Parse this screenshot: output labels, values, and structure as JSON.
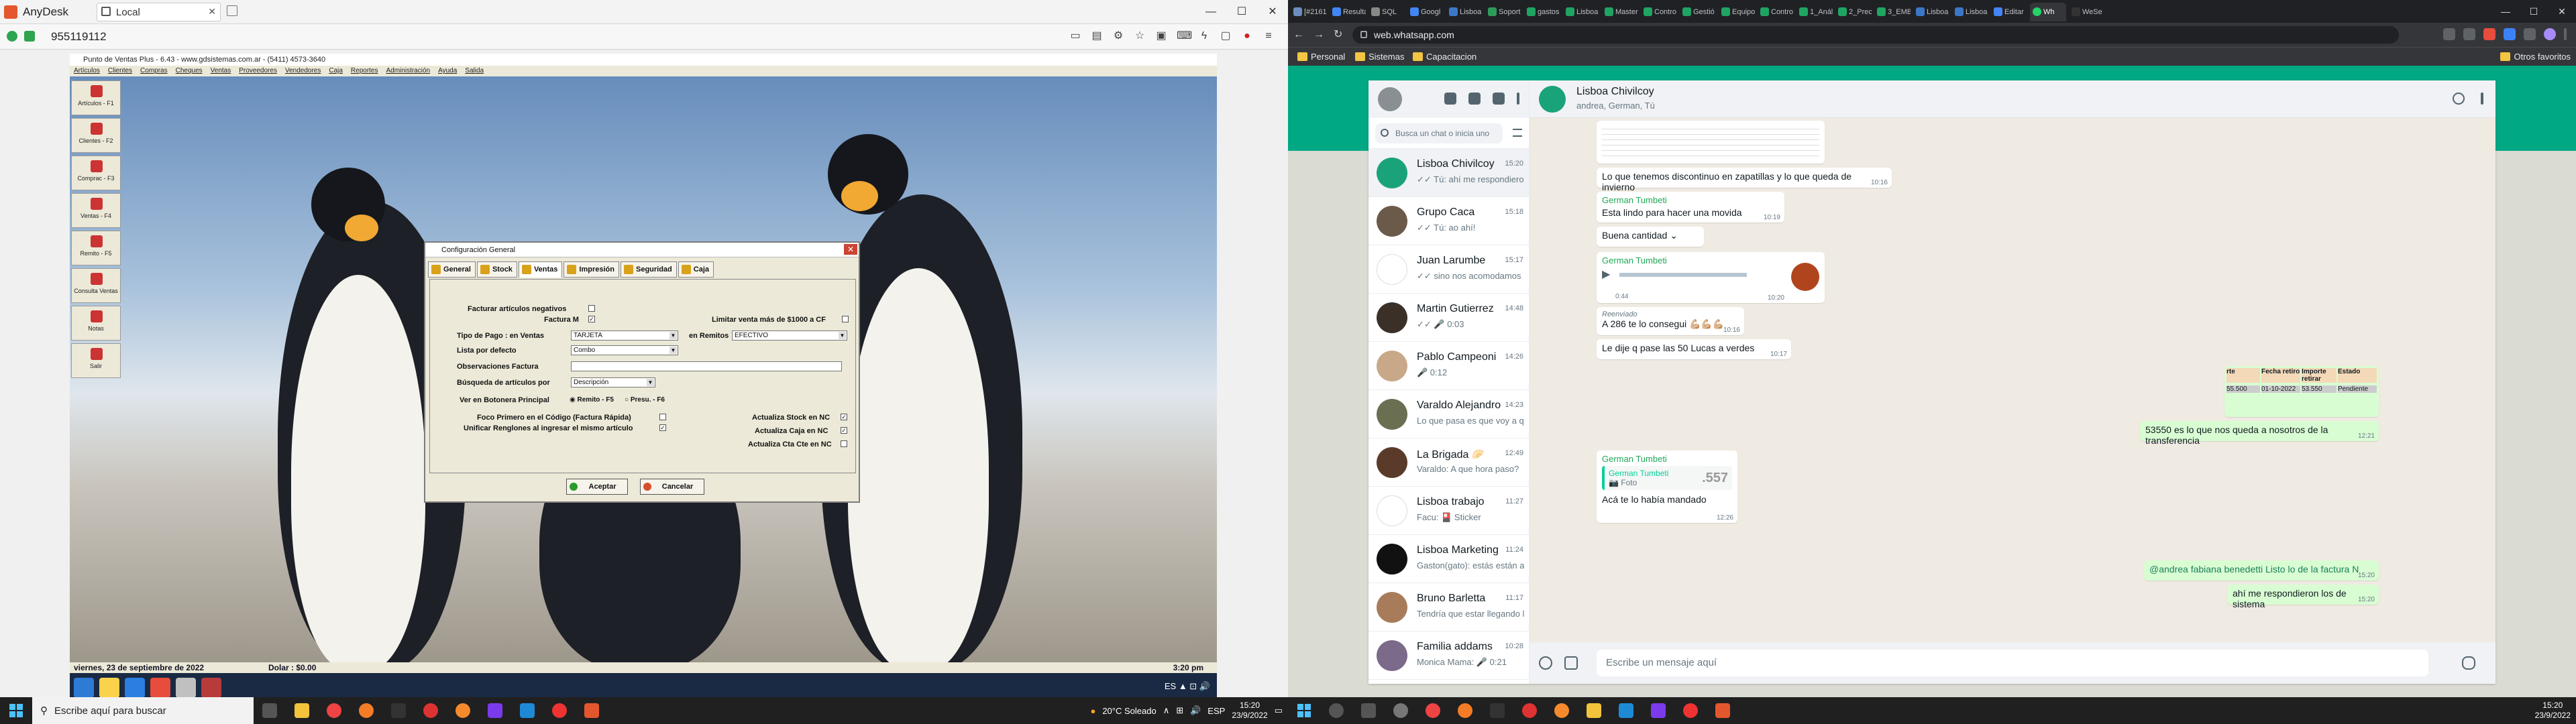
{
  "left": {
    "anydesk": {
      "app_name": "AnyDesk",
      "tab_label": "Local",
      "address": "955119112",
      "icons": [
        "chat-icon",
        "files-icon",
        "settings-icon",
        "star-icon",
        "monitor-icon",
        "keyboard-icon",
        "lightning-icon",
        "screenshot-icon",
        "record-icon",
        "menu-icon"
      ]
    },
    "pos": {
      "title": "Punto de Ventas Plus - 6.43 - www.gdsistemas.com.ar - (5411) 4573-3640",
      "menu": [
        "Artículos",
        "Clientes",
        "Compras",
        "Cheques",
        "Ventas",
        "Proveedores",
        "Vendedores",
        "Caja",
        "Reportes",
        "Administración",
        "Ayuda",
        "Salida"
      ],
      "side": [
        "Artículos - F1",
        "Clientes - F2",
        "Comprac - F3",
        "Ventas - F4",
        "Remito - F5",
        "Consulta Ventas",
        "Notas",
        "Salir"
      ],
      "status_date": "viernes, 23 de septiembre de 2022",
      "status_dolar": "Dolar : $0.00",
      "status_time": "3:20 pm"
    },
    "dialog": {
      "title": "Configuración General",
      "tabs": [
        "General",
        "Stock",
        "Ventas",
        "Impresión",
        "Seguridad",
        "Caja"
      ],
      "facturar_neg": "Facturar artículos negativos",
      "factura_m": "Factura M",
      "limitar": "Limitar venta más de $1000 a CF",
      "tipo_pago_lbl": "Tipo de Pago : en Ventas",
      "tipo_pago_val": "TARJETA",
      "remitos_lbl": "en Remitos",
      "remitos_val": "EFECTIVO",
      "lista_lbl": "Lista por defecto",
      "lista_val": "Combo",
      "obs_lbl": "Observaciones Factura",
      "busq_lbl": "Búsqueda de artículos por",
      "busq_val": "Descripción",
      "botonera_lbl": "Ver en Botonera Principal",
      "radio1": "Remito - F5",
      "radio2": "Presu. - F6",
      "foco": "Foco Primero en el Código (Factura Rápida)",
      "unificar": "Unificar Renglones al ingresar el mismo artículo",
      "act_stock": "Actualiza Stock en NC",
      "act_caja": "Actualiza Caja en NC",
      "act_cta": "Actualiza Cta Cte en NC",
      "ok": "Aceptar",
      "cancel": "Cancelar"
    },
    "taskbar": {
      "search": "Escribe aquí para buscar",
      "weather": "20°C Soleado",
      "lang": "ESP",
      "time": "15:20",
      "date": "23/9/2022"
    }
  },
  "right": {
    "chrome": {
      "tabs": [
        "[#2161",
        "Resulta",
        "SQL",
        "Googl",
        "Lisboa",
        "Soport",
        "gastos",
        "Lisboa",
        "Master",
        "Contro",
        "Gestió",
        "Equipo",
        "Contro",
        "1_Anál",
        "2_Prec",
        "3_EMB",
        "Lisboa",
        "Lisboa",
        "Editar",
        "Wh",
        "WeSe"
      ],
      "active_tab": 19,
      "url": "web.whatsapp.com",
      "bookmarks": [
        "Personal",
        "Sistemas",
        "Capacitacion"
      ],
      "other_bookmarks": "Otros favoritos"
    },
    "whatsapp": {
      "search_placeholder": "Busca un chat o inicia uno nuevo",
      "chats": [
        {
          "name": "Lisboa Chivilcoy",
          "time": "15:20",
          "preview": "✓✓ Tú: ahí me respondieron los de sistema"
        },
        {
          "name": "Grupo Caca",
          "time": "15:18",
          "preview": "✓✓ Tú: ao ahí!"
        },
        {
          "name": "Juan Larumbe",
          "time": "15:17",
          "preview": "✓✓ sino nos acomodamos"
        },
        {
          "name": "Martin Gutierrez",
          "time": "14:48",
          "preview": "✓✓ 🎤 0:03"
        },
        {
          "name": "Pablo Campeoni",
          "time": "14:26",
          "preview": "🎤 0:12"
        },
        {
          "name": "Varaldo Alejandro",
          "time": "14:23",
          "preview": "Lo que pasa es que voy a querer hacer algo con esa plata y..."
        },
        {
          "name": "La Brigada 🥟",
          "time": "12:49",
          "preview": "Varaldo: A que hora paso?"
        },
        {
          "name": "Lisboa trabajo",
          "time": "11:27",
          "preview": "Facu: 🎴 Sticker"
        },
        {
          "name": "Lisboa Marketing",
          "time": "11:24",
          "preview": "Gaston(gato): estás están andando en campañas de mensaje"
        },
        {
          "name": "Bruno Barletta",
          "time": "11:17",
          "preview": "Tendría que estar llegando la semana que viene"
        },
        {
          "name": "Familia addams",
          "time": "10:28",
          "preview": "Monica Mama: 🎤 0:21"
        }
      ],
      "header_name": "Lisboa Chivilcoy",
      "header_sub": "andrea, German, Tú",
      "msgs": {
        "m1": "Lo que tenemos discontinuo en zapatillas y lo que queda de invierno",
        "m1t": "10:16",
        "m2s": "German Tumbeti",
        "m2": "Esta lindo para hacer una movida",
        "m2t": "10:19",
        "poll": "Buena cantidad",
        "m3s": "German Tumbeti",
        "m3dur": "0:44",
        "m3t": "10:20",
        "fwd": "Reenviado",
        "m4": "A 286 te lo consegui 💪🏼💪🏼💪🏼",
        "m4t": "10:16",
        "m5": "Le dije q pase las 50 Lucas a verdes",
        "m5t": "10:17",
        "table_headers": [
          "rte",
          "Fecha retiro",
          "Importe retirar",
          "Estado"
        ],
        "table_row": [
          "55.500",
          "01-10-2022",
          "53.550",
          "Pendiente"
        ],
        "m6": "53550 es lo que nos queda a nosotros de la transferencia",
        "m6t": "12:21",
        "m7s": "German Tumbeti",
        "m7q": "German Tumbeti",
        "m7qt": "Foto",
        "m7qimg": ".557",
        "m7": "Acá te lo había mandado",
        "m7t": "12:26",
        "m8": "@andrea fabiana benedetti Listo lo de la factura N",
        "m8t": "15:20",
        "m9": "ahí me respondieron los de sistema",
        "m9t": "15:20"
      },
      "compose_placeholder": "Escribe un mensaje aquí"
    },
    "taskbar": {
      "time": "15:20",
      "date": "23/9/2022"
    }
  }
}
